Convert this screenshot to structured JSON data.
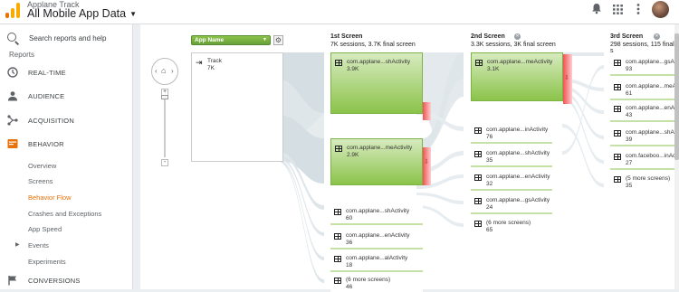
{
  "header": {
    "product": "Applane Track",
    "property": "All Mobile App Data",
    "icons": [
      "notifications-icon",
      "apps-grid-icon",
      "more-vert-icon",
      "avatar"
    ]
  },
  "sidebar": {
    "search_placeholder": "Search reports and help",
    "reports_label": "Reports",
    "nav": [
      {
        "label": "REAL-TIME",
        "icon": "clock-icon"
      },
      {
        "label": "AUDIENCE",
        "icon": "person-icon"
      },
      {
        "label": "ACQUISITION",
        "icon": "acquisition-icon"
      },
      {
        "label": "BEHAVIOR",
        "icon": "behavior-icon"
      }
    ],
    "behavior_sub": [
      "Overview",
      "Screens",
      "Behavior Flow",
      "Crashes and Exceptions",
      "App Speed",
      "Events",
      "Experiments"
    ],
    "current": "Behavior Flow",
    "conversions": "CONVERSIONS"
  },
  "flow": {
    "dimension_select": "App Name",
    "columns": [
      {
        "title": "1st Screen",
        "summary": "7K sessions, 3.7K final screen"
      },
      {
        "title": "2nd Screen",
        "summary": "3.3K sessions, 3K final screen"
      },
      {
        "title": "3rd Screen",
        "summary": "298 sessions, 115 final s"
      }
    ],
    "start_node": {
      "label": "Track",
      "value": "7K"
    },
    "col1_big": [
      {
        "label": "com.applane...shActivity",
        "value": "3.9K"
      },
      {
        "label": "com.applane...meActivity",
        "value": "2.9K"
      }
    ],
    "col1_small": [
      {
        "label": "com.applane...shActivity",
        "value": "60"
      },
      {
        "label": "com.applane...enActivity",
        "value": "36"
      },
      {
        "label": "com.applane...alActivity",
        "value": "18"
      },
      {
        "label": "(6 more screens)",
        "value": "46"
      }
    ],
    "col2_big": [
      {
        "label": "com.applane...meActivity",
        "value": "3.1K"
      }
    ],
    "col2_small": [
      {
        "label": "com.applane...inActivity",
        "value": "76"
      },
      {
        "label": "com.applane...shActivity",
        "value": "35"
      },
      {
        "label": "com.applane...enActivity",
        "value": "32"
      },
      {
        "label": "com.applane...gsActivity",
        "value": "24"
      },
      {
        "label": "(6 more screens)",
        "value": "65"
      }
    ],
    "col3_small": [
      {
        "label": "com.applane...gsAc",
        "value": "93"
      },
      {
        "label": "com.applane...meA",
        "value": "61"
      },
      {
        "label": "com.applane...enAc",
        "value": "43"
      },
      {
        "label": "com.applane...shAc",
        "value": "39"
      },
      {
        "label": "com.faceboo...inAc",
        "value": "27"
      },
      {
        "label": "(5 more screens)",
        "value": "35"
      }
    ]
  },
  "colors": {
    "green_top": "#c5e1a5",
    "green_bottom": "#8bc34a",
    "dropoff": "#e53935",
    "accent": "#e8710a"
  }
}
